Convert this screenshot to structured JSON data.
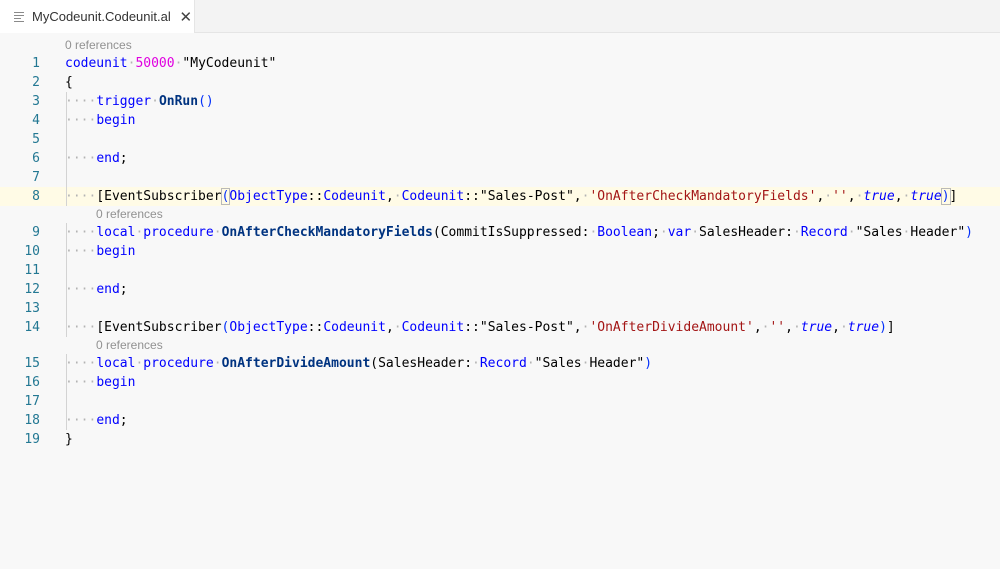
{
  "tab": {
    "title": "MyCodeunit.Codeunit.al",
    "icon": "file-lines-icon",
    "close_glyph": "✕"
  },
  "editor": {
    "codelens_label": "0 references",
    "lines": [
      {
        "n": "1",
        "text": "codeunit 50000 \"MyCodeunit\""
      },
      {
        "n": "2",
        "text": "{"
      },
      {
        "n": "3",
        "text": "    trigger OnRun()"
      },
      {
        "n": "4",
        "text": "    begin"
      },
      {
        "n": "5",
        "text": ""
      },
      {
        "n": "6",
        "text": "    end;"
      },
      {
        "n": "7",
        "text": ""
      },
      {
        "n": "8",
        "text": "    [EventSubscriber(ObjectType::Codeunit, Codeunit::\"Sales-Post\", 'OnAfterCheckMandatoryFields', '', true, true)]"
      },
      {
        "n": "9",
        "text": "    local procedure OnAfterCheckMandatoryFields(CommitIsSuppressed: Boolean; var SalesHeader: Record \"Sales Header\")"
      },
      {
        "n": "10",
        "text": "    begin"
      },
      {
        "n": "11",
        "text": ""
      },
      {
        "n": "12",
        "text": "    end;"
      },
      {
        "n": "13",
        "text": ""
      },
      {
        "n": "14",
        "text": "    [EventSubscriber(ObjectType::Codeunit, Codeunit::\"Sales-Post\", 'OnAfterDivideAmount', '', true, true)]"
      },
      {
        "n": "15",
        "text": "    local procedure OnAfterDivideAmount(SalesHeader: Record \"Sales Header\")"
      },
      {
        "n": "16",
        "text": "    begin"
      },
      {
        "n": "17",
        "text": ""
      },
      {
        "n": "18",
        "text": "    end;"
      },
      {
        "n": "19",
        "text": "}"
      }
    ]
  },
  "colors": {
    "keyword": "#0000ff",
    "number": "#e000e0",
    "string": "#a31515",
    "function": "#003380",
    "line_number": "#237893",
    "current_line": "#fffbe6"
  }
}
